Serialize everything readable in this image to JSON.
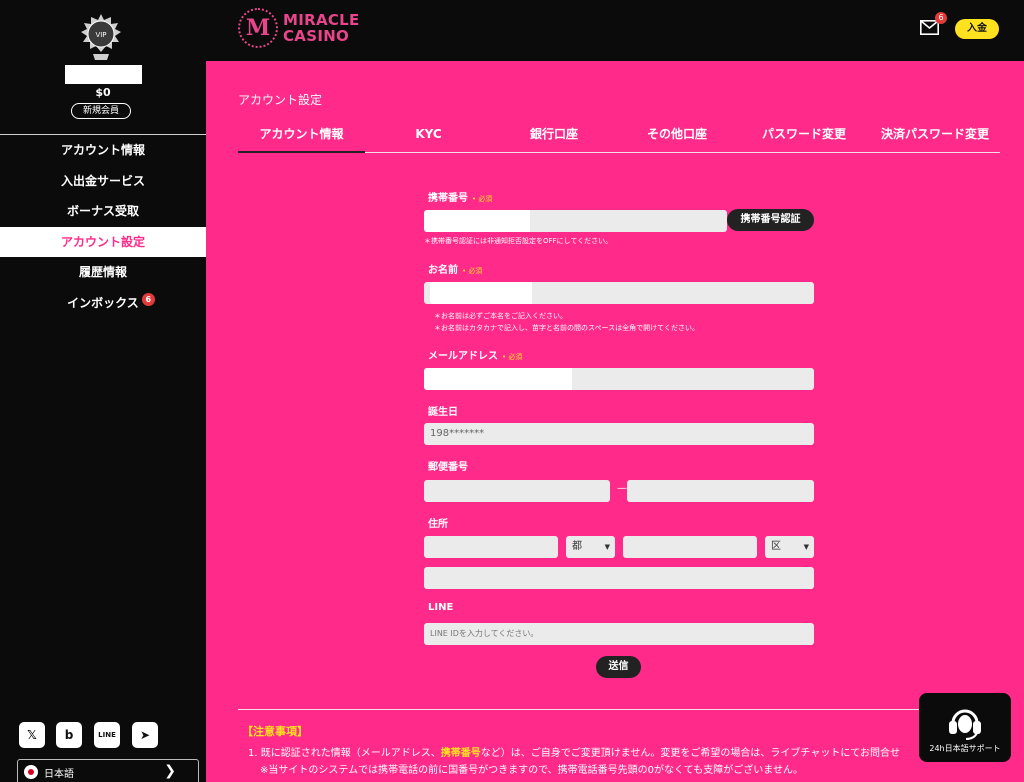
{
  "sidebar": {
    "vip_label": "VIP",
    "balance": "$0",
    "rank": "新規会員",
    "menu": [
      {
        "label": "アカウント情報",
        "active": false,
        "badge": ""
      },
      {
        "label": "入出金サービス",
        "active": false,
        "badge": ""
      },
      {
        "label": "ボーナス受取",
        "active": false,
        "badge": ""
      },
      {
        "label": "アカウント設定",
        "active": true,
        "badge": ""
      },
      {
        "label": "履歴情報",
        "active": false,
        "badge": ""
      },
      {
        "label": "インボックス",
        "active": false,
        "badge": "6"
      }
    ],
    "social": [
      {
        "icon": "x-icon",
        "glyph": "𝕏"
      },
      {
        "icon": "bluesky-icon",
        "glyph": "b"
      },
      {
        "icon": "line-icon",
        "glyph": "LINE"
      },
      {
        "icon": "telegram-icon",
        "glyph": "➤"
      }
    ],
    "language": "日本語"
  },
  "header": {
    "logo_line1": "MIRACLE",
    "logo_line2": "CASINO",
    "logo_mark": "M",
    "mail_badge": "6",
    "deposit_label": "入金"
  },
  "main": {
    "page_title": "アカウント設定",
    "tabs": [
      "アカウント情報",
      "KYC",
      "銀行口座",
      "その他口座",
      "パスワード変更",
      "決済パスワード変更"
    ],
    "form": {
      "phone_label": "携帯番号",
      "required": "• 必須",
      "phone_verify_button": "携帯番号認証",
      "phone_note": "＊携帯番号認証には非通知拒否設定をOFFにしてください。",
      "name_label": "お名前",
      "name_note1": "＊お名前は必ずご本名をご記入ください。",
      "name_note2": "＊お名前はカタカナで記入し、苗字と名前の間のスペースは全角で開けてください。",
      "email_label": "メールアドレス",
      "birthday_label": "誕生日",
      "birthday_value": "198*******",
      "postal_label": "郵便番号",
      "postal_dash": "—",
      "address_label": "住所",
      "address_pref_select": "都",
      "address_ward_select": "区",
      "line_label": "LINE",
      "line_placeholder": "LINE IDを入力してください。",
      "submit_label": "送信"
    },
    "notice": {
      "title": "【注意事項】",
      "line1_a": "1. 既に認証された情報（メールアドレス、",
      "line1_hl": "携帯番号",
      "line1_b": "など）は、ご自身でご変更頂けません。変更をご希望の場合は、ライブチャットにてお問合せ",
      "line2": "※当サイトのシステムでは携帯電話の前に国番号がつきますので、携帯電話番号先頭の0がなくても支障がございません。"
    }
  },
  "support": {
    "label": "24h日本語サポート"
  },
  "colors": {
    "main_bg": "#ff2a8a",
    "accent_yellow": "#ffe21f",
    "sidebar_bg": "#0b0b0b",
    "logo": "#e8458a"
  }
}
